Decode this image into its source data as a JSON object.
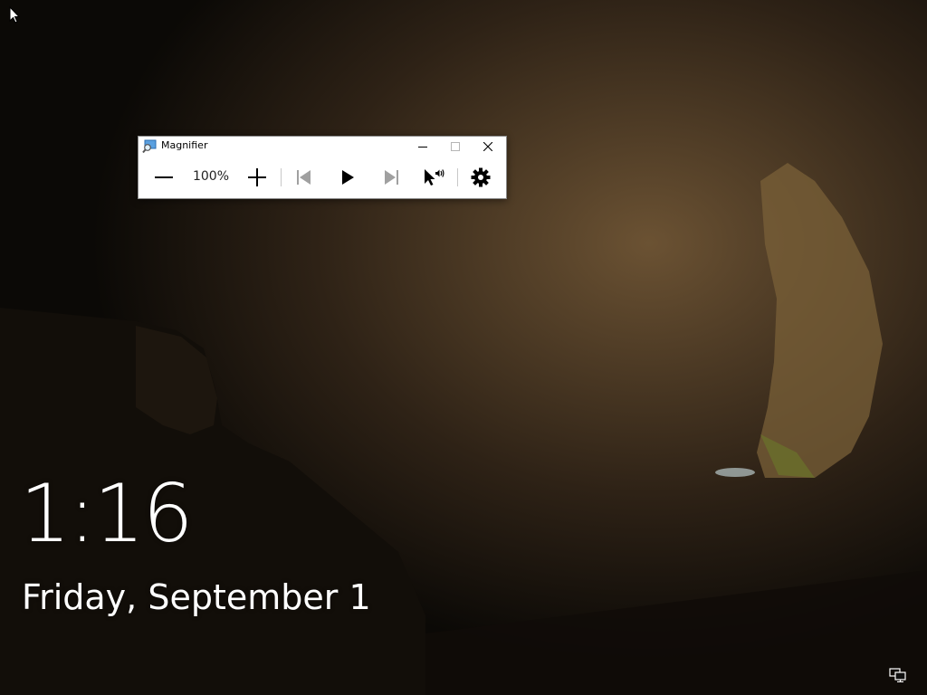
{
  "magnifier": {
    "title": "Magnifier",
    "zoom_level": "100%"
  },
  "lockscreen": {
    "time": "1:16",
    "date": "Friday, September 1"
  },
  "icons": {
    "app": "magnifier-app-icon",
    "minimize": "minimize-icon",
    "maximize": "maximize-icon",
    "close": "close-icon",
    "zoom_out": "minus-icon",
    "zoom_in": "plus-icon",
    "previous": "skip-previous-icon",
    "play": "play-icon",
    "next": "skip-next-icon",
    "read_from_pointer": "pointer-speaker-icon",
    "settings": "gear-icon",
    "network": "network-icon",
    "cursor": "mouse-cursor-icon"
  },
  "colors": {
    "window_bg": "#ffffff",
    "icon_active": "#000000",
    "icon_disabled": "#a0a0a0",
    "lock_text": "#ffffff"
  }
}
